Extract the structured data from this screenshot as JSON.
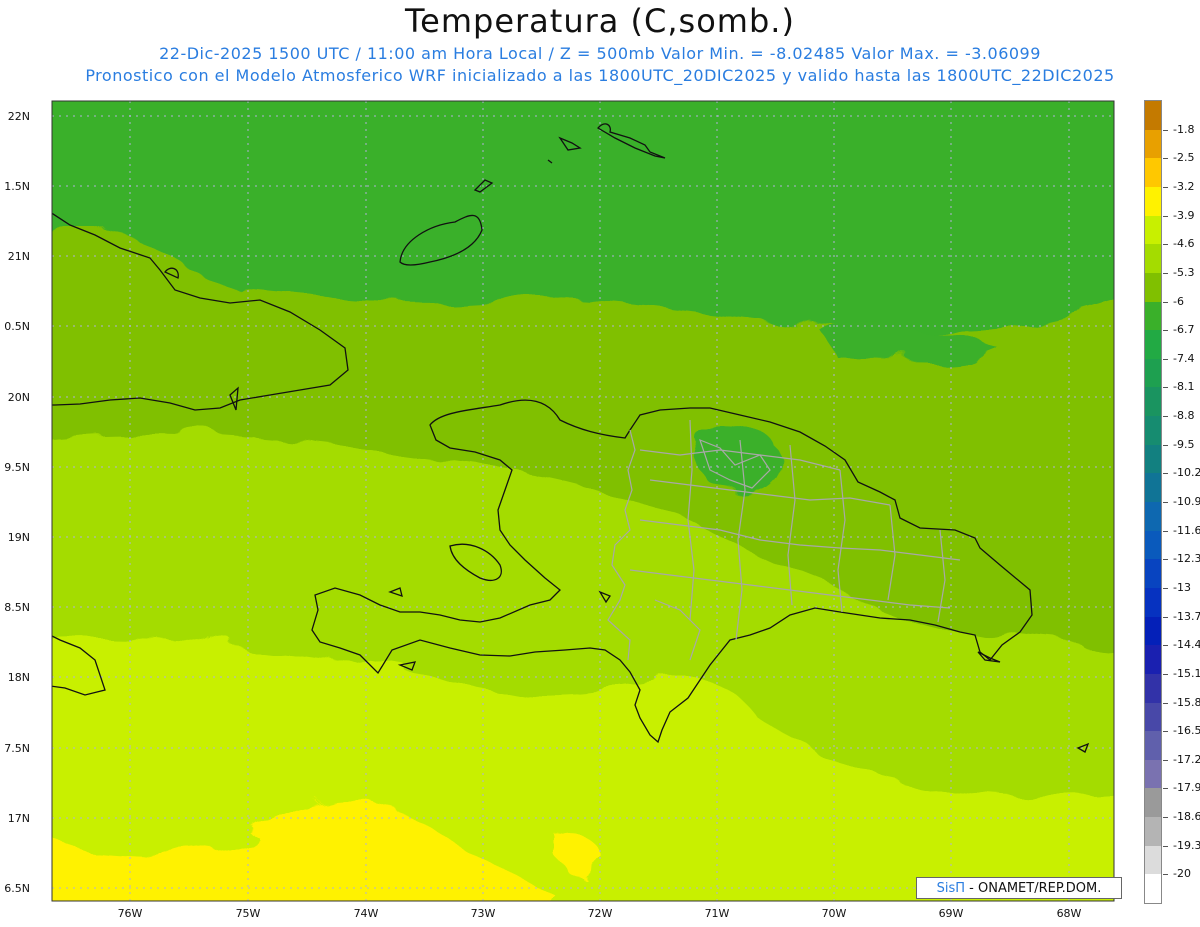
{
  "title": "Temperatura (C,somb.)",
  "subtitle_line1": "22-Dic-2025  1500 UTC / 11:00 am Hora Local / Z = 500mb  Valor Min. = -8.02485  Valor Max. = -3.06099",
  "subtitle_line2": "Pronostico con el Modelo Atmosferico WRF inicializado a las 1800UTC_20DIC2025 y valido hasta las  1800UTC_22DIC2025",
  "lat_labels": [
    "22N",
    "1.5N",
    "21N",
    "0.5N",
    "20N",
    "9.5N",
    "19N",
    "8.5N",
    "18N",
    "7.5N",
    "17N",
    "6.5N"
  ],
  "lon_labels": [
    "76W",
    "75W",
    "74W",
    "73W",
    "72W",
    "71W",
    "70W",
    "69W",
    "68W"
  ],
  "legend": {
    "labels": [
      "-1.8",
      "-2.5",
      "-3.2",
      "-3.9",
      "-4.6",
      "-5.3",
      "-6",
      "-6.7",
      "-7.4",
      "-8.1",
      "-8.8",
      "-9.5",
      "-10.2",
      "-10.9",
      "-11.6",
      "-12.3",
      "-13",
      "-13.7",
      "-14.4",
      "-15.1",
      "-15.8",
      "-16.5",
      "-17.2",
      "-17.9",
      "-18.6",
      "-19.3",
      "-20"
    ],
    "colors": [
      "#c47a00",
      "#e8a000",
      "#ffc800",
      "#fff200",
      "#c8f000",
      "#a4dc00",
      "#80c000",
      "#3ab02a",
      "#22aa44",
      "#1ea050",
      "#1a9460",
      "#168c70",
      "#128080",
      "#107496",
      "#0e68b0",
      "#0a5abc",
      "#0844c0",
      "#0632c0",
      "#0420b8",
      "#1a20b0",
      "#3232a8",
      "#4848a8",
      "#6060ac",
      "#7a72b0",
      "#9a9a9a",
      "#b4b4b4",
      "#dcdcdc",
      "#ffffff"
    ]
  },
  "credit": {
    "brand": "SisΠ",
    "text": "- ONAMET/REP.DOM."
  }
}
